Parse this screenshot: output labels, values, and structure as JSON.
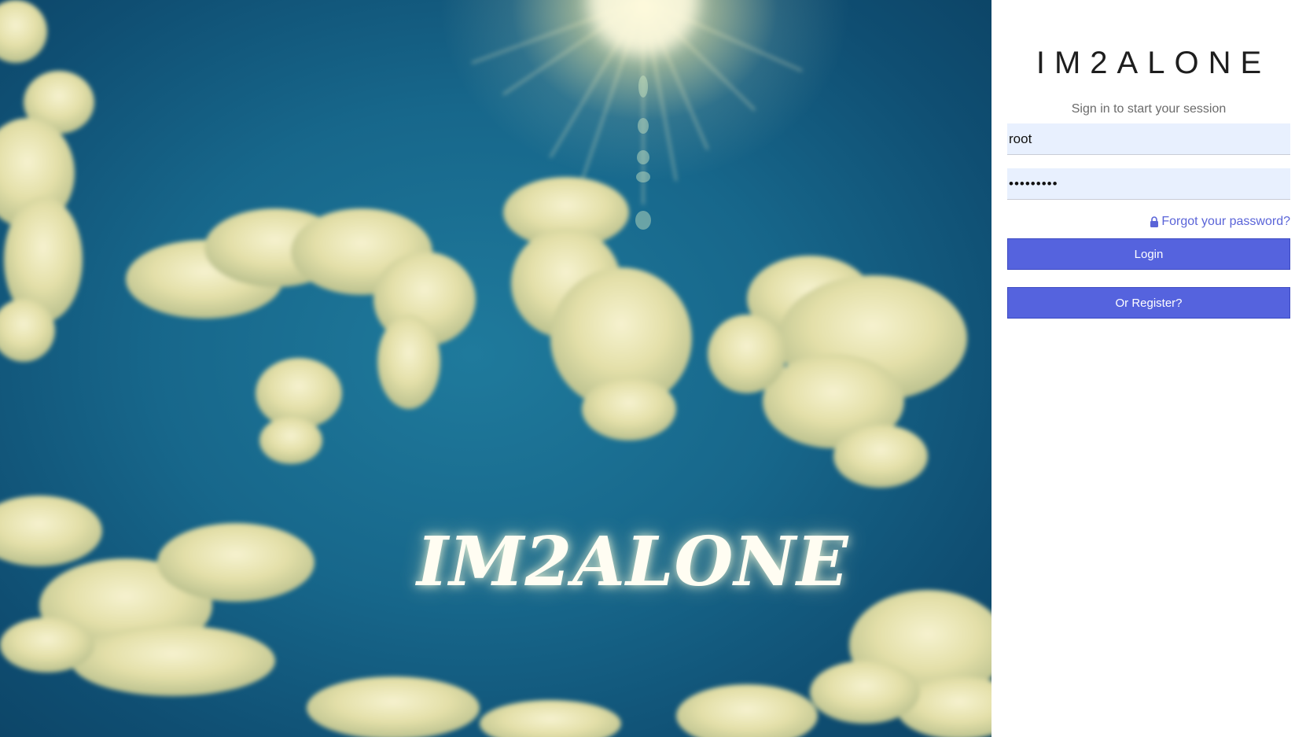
{
  "hero": {
    "logo_text": "IM2ALONE"
  },
  "login": {
    "brand_title": "IM2ALONE",
    "subtitle": "Sign in to start your session",
    "username_value": "root",
    "password_value": "•••••••••",
    "forgot_password_label": "Forgot your password?",
    "login_button_label": "Login",
    "register_button_label": "Or Register?"
  },
  "colors": {
    "accent": "#5563de",
    "link": "#5a64d8",
    "input_bg": "#e8f0fe"
  },
  "icons": {
    "forgot_password": "lock-icon"
  }
}
